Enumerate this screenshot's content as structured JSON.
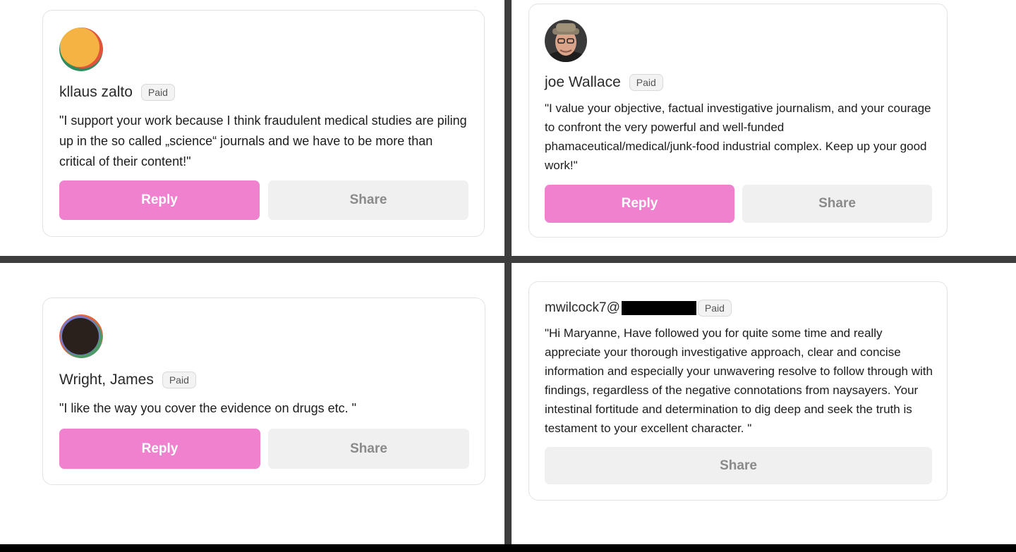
{
  "comments": [
    {
      "name": "kllaus zalto",
      "badge": "Paid",
      "text": "\"I support your work because I think fraudulent medical studies are piling up in the so called „science“ journals and we have to be more than critical of their content!\"",
      "reply_label": "Reply",
      "share_label": "Share"
    },
    {
      "name": "joe Wallace",
      "badge": "Paid",
      "text": "\"I value your objective, factual investigative journalism, and your courage to confront the very powerful and well-funded phamaceutical/medical/junk-food industrial complex. Keep up your good work!\"",
      "reply_label": "Reply",
      "share_label": "Share"
    },
    {
      "name": "Wright, James",
      "badge": "Paid",
      "text": "\"I like the way you cover the evidence on drugs etc. \"",
      "reply_label": "Reply",
      "share_label": "Share"
    },
    {
      "name": "mwilcock7@",
      "badge": "Paid",
      "text": "\"Hi Maryanne, Have followed you for quite some time and really appreciate your thorough investigative approach, clear and concise information and especially your unwavering resolve to follow through with findings, regardless of the negative connotations from naysayers. Your intestinal fortitude and determination to dig deep and seek the truth is testament to your excellent character. \"",
      "share_label": "Share"
    }
  ],
  "colors": {
    "reply_button": "#f081cf",
    "share_button": "#f0f0f0",
    "divider": "#3d3d3d"
  }
}
